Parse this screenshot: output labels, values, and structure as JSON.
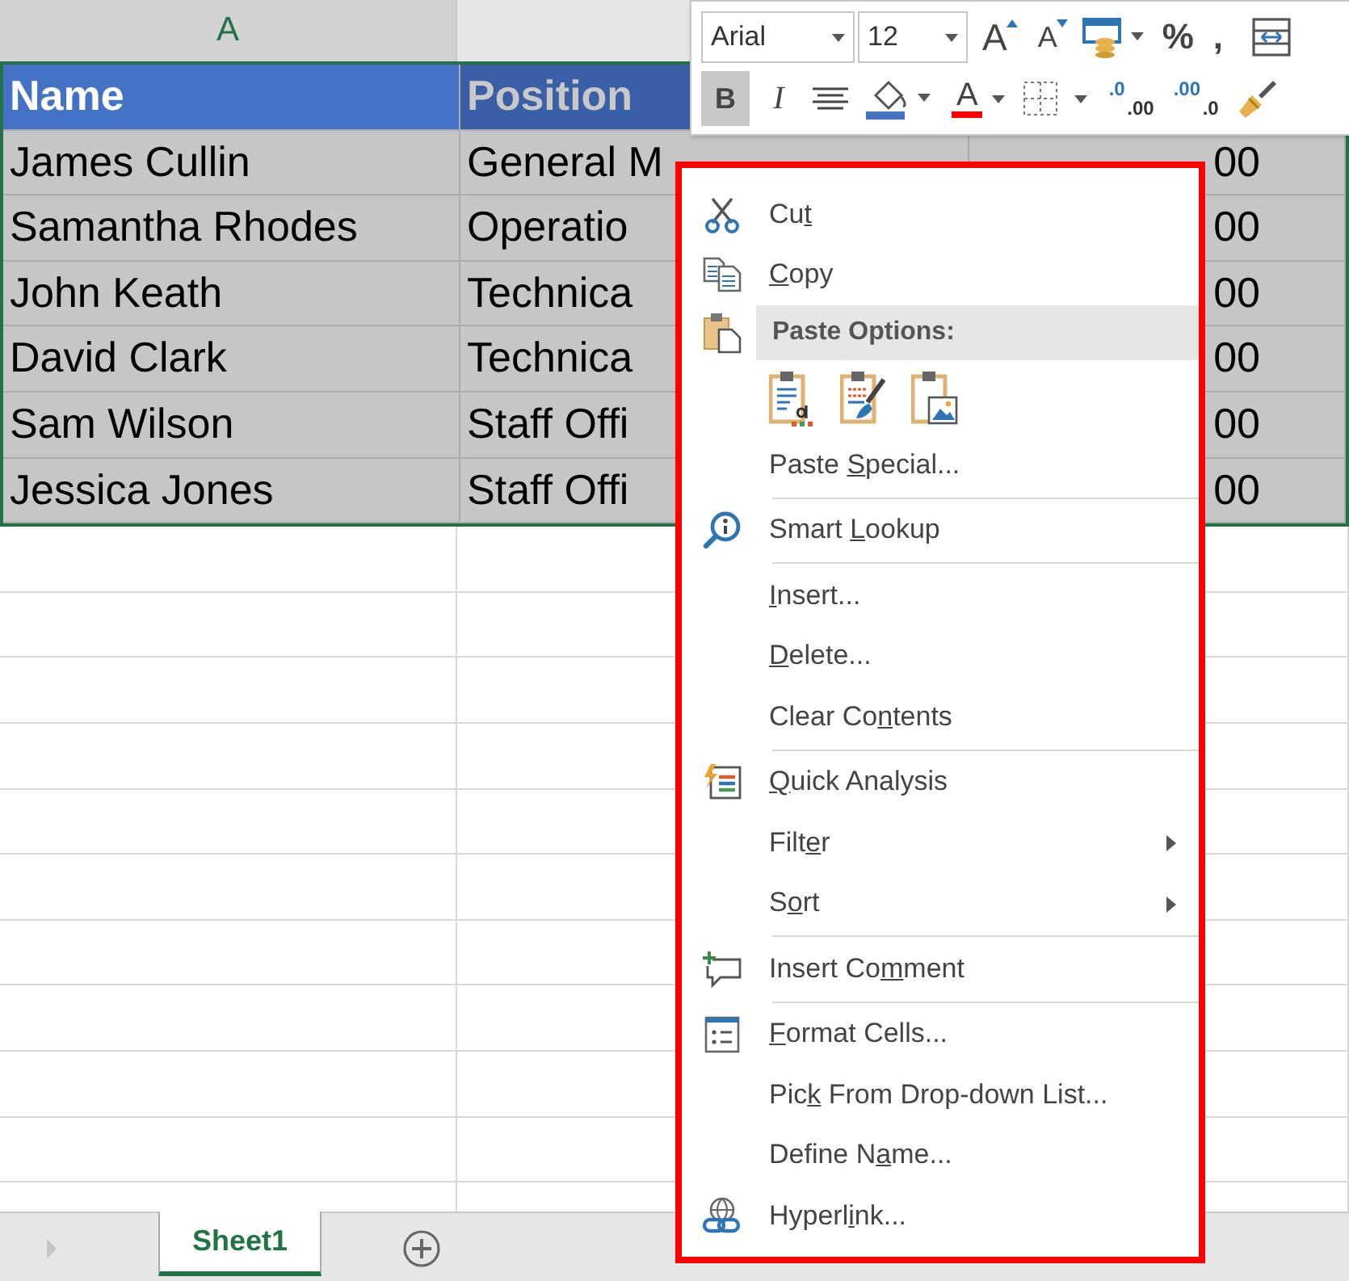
{
  "sheet": {
    "columns": [
      {
        "label": "A",
        "selected": true
      }
    ],
    "header": [
      {
        "text": "Name",
        "active": true
      },
      {
        "text": "Position",
        "active": false
      }
    ],
    "rows": [
      [
        "James Cullin",
        "General M",
        "00"
      ],
      [
        "Samantha Rhodes",
        "Operatio",
        "00"
      ],
      [
        "John Keath",
        "Technica",
        "00"
      ],
      [
        "David Clark",
        "Technica",
        "00"
      ],
      [
        "Sam Wilson",
        "Staff Offi",
        "00"
      ],
      [
        "Jessica Jones",
        "Staff Offi",
        "00"
      ]
    ],
    "range_selected": true
  },
  "mini_toolbar": {
    "font": {
      "value": "Arial"
    },
    "size": {
      "value": "12"
    },
    "row1": [
      {
        "kind": "grow",
        "label": "A"
      },
      {
        "kind": "shrink",
        "label": "A"
      },
      {
        "kind": "table_format"
      },
      {
        "kind": "text",
        "label": "%"
      },
      {
        "kind": "text",
        "label": ","
      },
      {
        "kind": "wrap"
      }
    ],
    "row2": [
      {
        "kind": "bold",
        "label": "B",
        "pressed": true
      },
      {
        "kind": "italic",
        "label": "I",
        "pressed": false
      },
      {
        "kind": "align",
        "pressed": false
      },
      {
        "kind": "fill",
        "color": "#4472c4"
      },
      {
        "kind": "font_color",
        "label": "A",
        "color": "#ff0000"
      },
      {
        "kind": "borders"
      },
      {
        "kind": "inc_decimal",
        "labels": [
          ".0",
          ".00"
        ]
      },
      {
        "kind": "dec_decimal",
        "labels": [
          ".00",
          ".0"
        ]
      },
      {
        "kind": "painter"
      }
    ]
  },
  "context_menu": {
    "items": [
      {
        "kind": "item",
        "pre": "Cu",
        "key": "t",
        "submenu": false
      },
      {
        "kind": "item",
        "key": "C",
        "post": "opy",
        "submenu": false
      },
      {
        "kind": "header",
        "text": "Paste Options:"
      },
      {
        "kind": "paste_icons"
      },
      {
        "kind": "item",
        "pre": "Paste ",
        "key": "S",
        "post": "pecial...",
        "submenu": false
      },
      {
        "kind": "separator"
      },
      {
        "kind": "item",
        "pre": "Smart ",
        "key": "L",
        "post": "ookup",
        "submenu": false
      },
      {
        "kind": "separator"
      },
      {
        "kind": "item",
        "key": "I",
        "post": "nsert...",
        "submenu": false
      },
      {
        "kind": "item",
        "key": "D",
        "post": "elete...",
        "submenu": false
      },
      {
        "kind": "item",
        "pre": "Clear Co",
        "key": "n",
        "post": "tents",
        "submenu": false
      },
      {
        "kind": "separator"
      },
      {
        "kind": "item",
        "key": "Q",
        "post": "uick Analysis",
        "submenu": false
      },
      {
        "kind": "item",
        "pre": "Filt",
        "key": "e",
        "post": "r",
        "submenu": true
      },
      {
        "kind": "item",
        "pre": "S",
        "key": "o",
        "post": "rt",
        "submenu": true
      },
      {
        "kind": "separator"
      },
      {
        "kind": "item",
        "pre": "Insert Co",
        "key": "m",
        "post": "ment",
        "submenu": false
      },
      {
        "kind": "separator"
      },
      {
        "kind": "item",
        "key": "F",
        "post": "ormat Cells...",
        "submenu": false
      },
      {
        "kind": "item",
        "pre": "Pic",
        "key": "k",
        "post": " From Drop-down List...",
        "submenu": false
      },
      {
        "kind": "item",
        "pre": "Define N",
        "key": "a",
        "post": "me...",
        "submenu": false
      },
      {
        "kind": "item",
        "pre": "Hyperl",
        "key": "i",
        "post": "nk...",
        "submenu": false
      }
    ]
  },
  "sheet_tabs": [
    {
      "label": "Sheet1",
      "selected": true
    }
  ]
}
